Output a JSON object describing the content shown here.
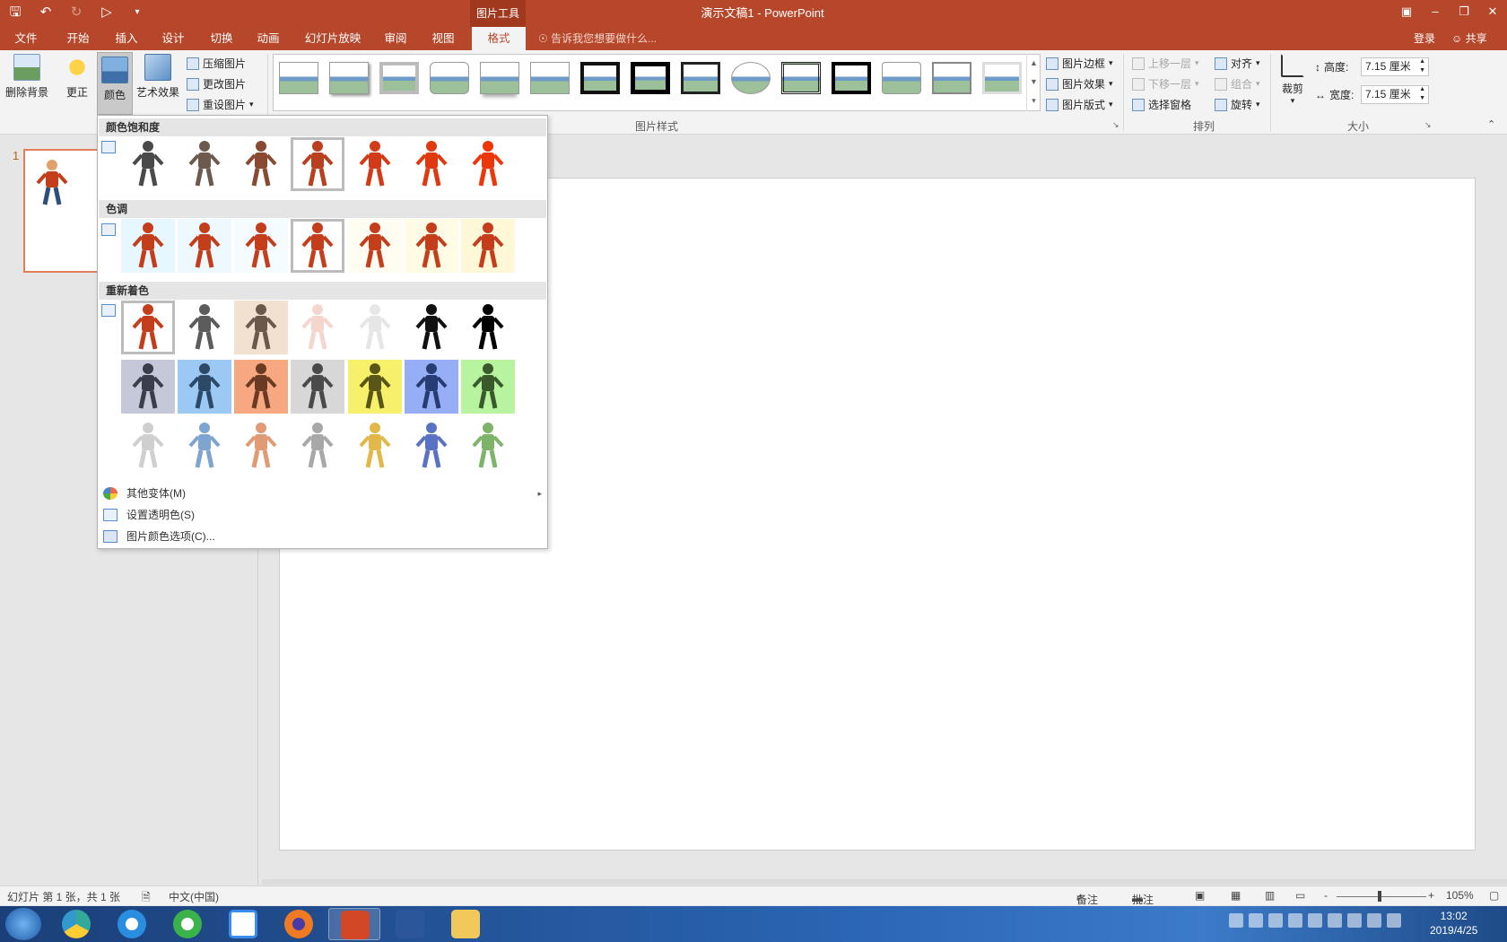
{
  "title_bar": {
    "context_tab": "图片工具",
    "doc_title": "演示文稿1 - PowerPoint",
    "qat_icons": [
      "save-icon",
      "undo-icon",
      "redo-icon",
      "slideshow-icon",
      "customize-icon"
    ],
    "window_icons": [
      "ribbon-display-icon",
      "minimize-icon",
      "restore-icon",
      "close-icon"
    ]
  },
  "tabs": [
    "文件",
    "开始",
    "插入",
    "设计",
    "切换",
    "动画",
    "幻灯片放映",
    "审阅",
    "视图",
    "格式"
  ],
  "active_tab": "格式",
  "tell_me": "告诉我您想要做什么...",
  "account": {
    "login": "登录",
    "share": "共享"
  },
  "ribbon": {
    "remove_bg": "删除背景",
    "corrections": "更正",
    "color": "颜色",
    "artistic": "艺术效果",
    "compress": "压缩图片",
    "change": "更改图片",
    "reset": "重设图片",
    "styles_group": "图片样式",
    "border": "图片边框",
    "effects": "图片效果",
    "layout": "图片版式",
    "bring_forward": "上移一层",
    "send_backward": "下移一层",
    "selection_pane": "选择窗格",
    "align": "对齐",
    "group": "组合",
    "rotate": "旋转",
    "arrange_group": "排列",
    "crop": "裁剪",
    "height_label": "高度:",
    "height_value": "7.15 厘米",
    "width_label": "宽度:",
    "width_value": "7.15 厘米",
    "size_group": "大小"
  },
  "slide_panel": {
    "slide_number": "1"
  },
  "color_menu": {
    "saturation": "颜色饱和度",
    "tone": "色调",
    "recolor": "重新着色",
    "saturation_swatches": [
      "#4a4a4a",
      "#6d5a4e",
      "#8a4a32",
      "#b8401f",
      "#d23a18",
      "#e0380f",
      "#ef3608"
    ],
    "saturation_selected": 3,
    "tone_swatches": [
      "#e6f7ff",
      "#edf9ff",
      "#f4fcff",
      "#ffffff",
      "#fffdf2",
      "#fffbe5",
      "#fff8d8"
    ],
    "tone_selected": 3,
    "recolor_rows": [
      [
        {
          "bg": "#ffffff",
          "fig": "#c43e1c"
        },
        {
          "bg": "#ffffff",
          "fig": "#5c5c5c"
        },
        {
          "bg": "#f2e1d0",
          "fig": "#6b5a4c"
        },
        {
          "bg": "#ffffff",
          "fig": "#f4d6cc"
        },
        {
          "bg": "#ffffff",
          "fig": "#e6e6e6"
        },
        {
          "bg": "#ffffff",
          "fig": "#111111"
        },
        {
          "bg": "#ffffff",
          "fig": "#000000"
        }
      ],
      [
        {
          "bg": "#c5c8d8",
          "fig": "#3a3d4a"
        },
        {
          "bg": "#9cc8f4",
          "fig": "#2c4a68"
        },
        {
          "bg": "#f8a880",
          "fig": "#6a3a24"
        },
        {
          "bg": "#d7d7d7",
          "fig": "#4a4a4a"
        },
        {
          "bg": "#f6f06a",
          "fig": "#5a5618"
        },
        {
          "bg": "#96aef6",
          "fig": "#283c74"
        },
        {
          "bg": "#b8f4a0",
          "fig": "#3a5a2c"
        }
      ],
      [
        {
          "bg": "#ffffff",
          "fig": "#cfcfcf"
        },
        {
          "bg": "#ffffff",
          "fig": "#7ea4d0"
        },
        {
          "bg": "#ffffff",
          "fig": "#e09a74"
        },
        {
          "bg": "#ffffff",
          "fig": "#a8a8a8"
        },
        {
          "bg": "#ffffff",
          "fig": "#e2b84a"
        },
        {
          "bg": "#ffffff",
          "fig": "#5a72c4"
        },
        {
          "bg": "#ffffff",
          "fig": "#7eb46a"
        }
      ]
    ],
    "recolor_selected": 0,
    "more_variations": "其他变体(M)",
    "set_transparent": "设置透明色(S)",
    "color_options": "图片颜色选项(C)..."
  },
  "status_bar": {
    "slide_info": "幻灯片 第 1 张，共 1 张",
    "language": "中文(中国)",
    "notes": "备注",
    "comments": "批注",
    "zoom_minus": "-",
    "zoom_plus": "+",
    "zoom": "105%",
    "zoom_level_fraction": 0.46
  },
  "taskbar": {
    "apps": [
      "360-safe",
      "ie",
      "360-browser",
      "baidu-netdisk",
      "firefox",
      "powerpoint",
      "word",
      "file-explorer"
    ],
    "active_app": "powerpoint",
    "time": "13:02",
    "date": "2019/4/25"
  }
}
